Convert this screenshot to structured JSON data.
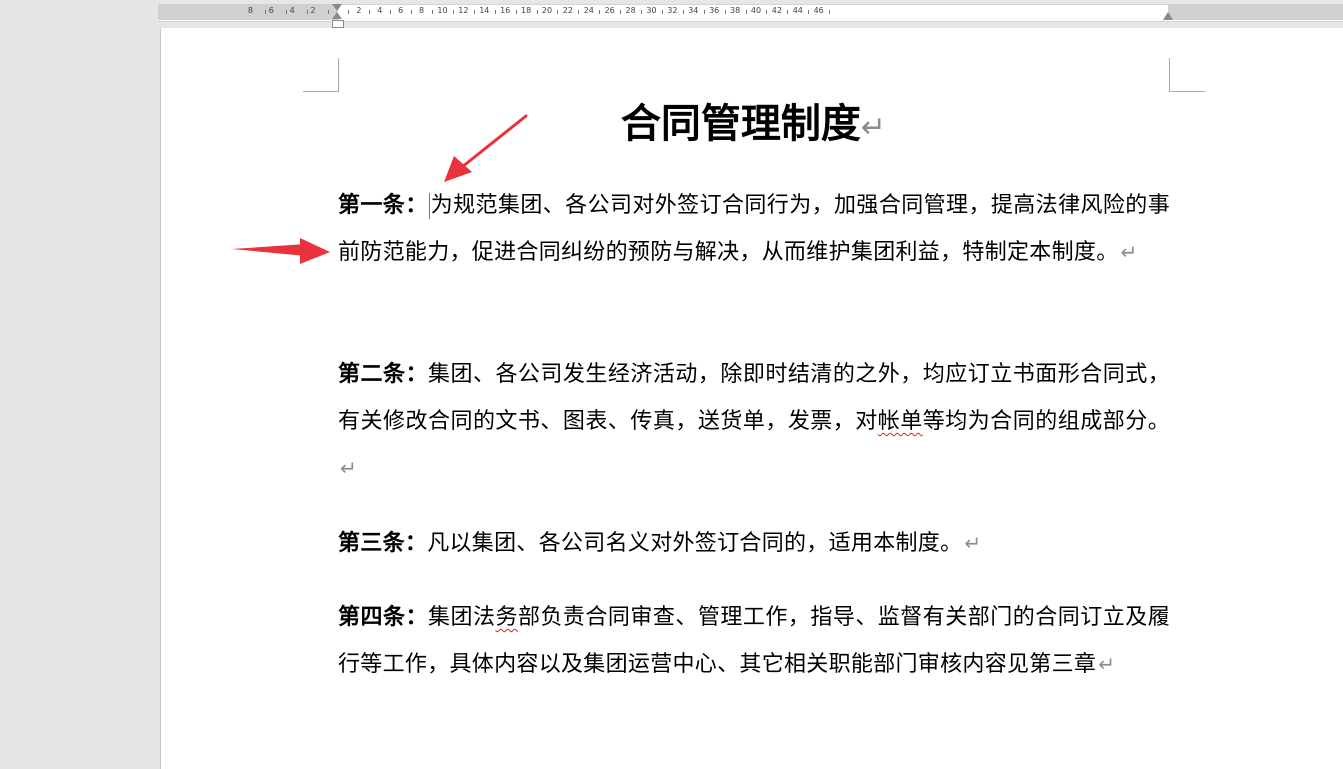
{
  "ruler": {
    "ticks_left": [
      "8",
      "6",
      "4",
      "2"
    ],
    "ticks_right": [
      "2",
      "4",
      "6",
      "8",
      "10",
      "12",
      "14",
      "16",
      "18",
      "20",
      "22",
      "24",
      "26",
      "28",
      "30",
      "32",
      "34",
      "36",
      "38",
      "40",
      "42",
      "44",
      "46"
    ]
  },
  "document": {
    "title": "合同管理制度",
    "paragraph_mark": "↵",
    "articles": [
      {
        "heading": "第一条：",
        "text_before_caret": "",
        "text": "为规范集团、各公司对外签订合同行为，加强合同管理，提高法律风险的事前防范能力，促进合同纠纷的预防与解决，从而维护集团利益，特制定本制度。"
      },
      {
        "heading": "第二条：",
        "text_a": "集团、各公司发生经济活动，除即时结清的之外，均应订立书面形合同式，有关修改合同的文书、图表、传真，送货单，发票，对",
        "text_flagged": "帐单",
        "text_b": "等均为合同的组成部分。"
      },
      {
        "heading": "第三条：",
        "text": "凡以集团、各公司名义对外签订合同的，适用本制度。"
      },
      {
        "heading": "第四条：",
        "text_a": "集团法",
        "text_flagged": "务",
        "text_b": "部负责合同审查、管理工作，指导、监督有关部门的合同订立及履行等工作，具体内容以及集团运营中心、其它相关职能部门审核内容见第三章"
      }
    ]
  },
  "annotations": {
    "arrow_color": "#e8323c"
  }
}
